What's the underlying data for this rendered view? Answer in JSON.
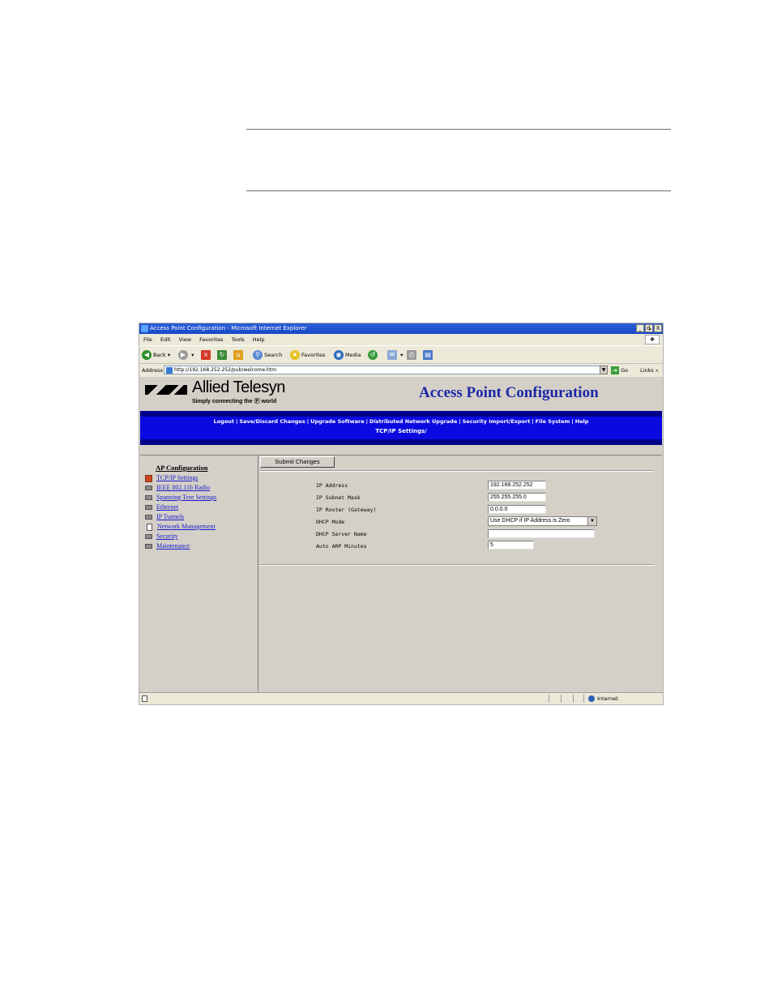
{
  "window": {
    "title": "Access Point Configuration - Microsoft Internet Explorer",
    "buttons": [
      "_",
      "ȡ",
      "X"
    ]
  },
  "menu": [
    "File",
    "Edit",
    "View",
    "Favorites",
    "Tools",
    "Help"
  ],
  "toolbar": {
    "back": "Back",
    "search": "Search",
    "favorites": "Favorites",
    "media": "Media"
  },
  "address": {
    "label": "Address",
    "url": "http://192.168.252.252/pub/welcome.htm",
    "go": "Go",
    "links": "Links »"
  },
  "banner": {
    "brand": "Allied Telesyn",
    "tagline": "Simply connecting the Ⓟ world",
    "title": "Access Point Configuration"
  },
  "nav": {
    "links": [
      "Logout",
      "Save/Discard Changes",
      "Upgrade Software",
      "Distributed Network Upgrade",
      "Security Import/Export",
      "File System",
      "Help"
    ],
    "breadcrumb": "TCP/IP Settings/"
  },
  "sidebar": {
    "title": "AP Configuration",
    "items": [
      {
        "label": "TCP/IP Settings",
        "icon": "folder-open-icon"
      },
      {
        "label": "IEEE 802.11b Radio",
        "icon": "folder-icon"
      },
      {
        "label": "Spanning Tree Settings",
        "icon": "folder-icon"
      },
      {
        "label": "Ethernet",
        "icon": "folder-icon"
      },
      {
        "label": "IP Tunnels",
        "icon": "folder-icon"
      },
      {
        "label": "Network Management",
        "icon": "document-icon"
      },
      {
        "label": "Security",
        "icon": "folder-icon"
      },
      {
        "label": "Maintenance",
        "icon": "folder-icon"
      }
    ]
  },
  "form": {
    "submit_label": "Submit Changes",
    "fields": [
      {
        "label": "IP Address",
        "value": "192.168.252.252"
      },
      {
        "label": "IP Subnet Mask",
        "value": "255.255.255.0"
      },
      {
        "label": "IP Router (Gateway)",
        "value": "0.0.0.0"
      },
      {
        "label": "DHCP Mode",
        "value": "Use DHCP if IP Address is Zero"
      },
      {
        "label": "DHCP Server Name",
        "value": ""
      },
      {
        "label": "Auto ARP Minutes",
        "value": "5"
      }
    ]
  },
  "status": {
    "zone": "Internet"
  }
}
